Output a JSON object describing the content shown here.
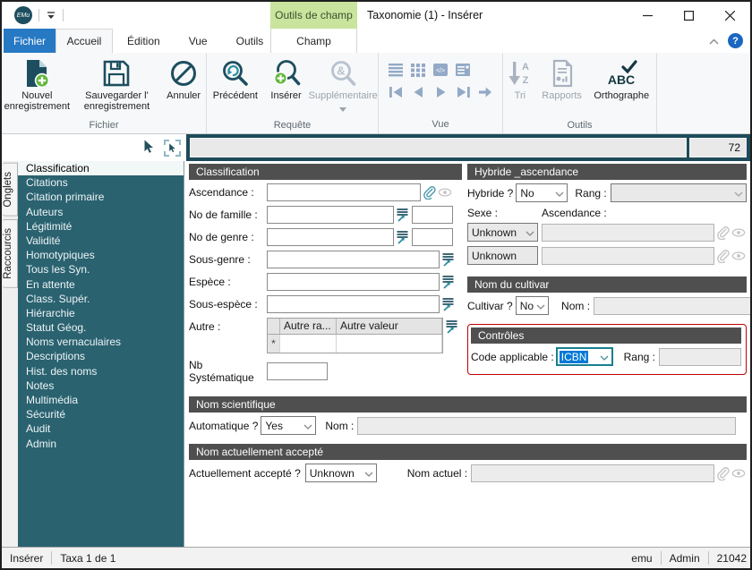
{
  "window": {
    "logo": "EMu",
    "title": "Taxonomie (1) - Insérer",
    "contextual_tab": "Outils de champ",
    "help": "?"
  },
  "tabs": {
    "fichier": "Fichier",
    "accueil": "Accueil",
    "edition": "Édition",
    "vue": "Vue",
    "outils": "Outils",
    "champ": "Champ"
  },
  "ribbon": {
    "groups": [
      {
        "label": "Fichier",
        "buttons": [
          {
            "label": "Nouvel enregistrement"
          },
          {
            "label": "Sauvegarder l' enregistrement"
          },
          {
            "label": "Annuler"
          }
        ]
      },
      {
        "label": "Requête",
        "buttons": [
          {
            "label": "Précédent"
          },
          {
            "label": "Insérer"
          },
          {
            "label": "Supplémentaire"
          }
        ]
      },
      {
        "label": "Vue"
      },
      {
        "label": "Outils",
        "buttons": [
          {
            "label": "Tri"
          },
          {
            "label": "Rapports"
          },
          {
            "label": "Orthographe"
          }
        ]
      }
    ]
  },
  "toolstrip": {
    "record_count": "72"
  },
  "sidebar": {
    "tabs": [
      "Onglets",
      "Raccourcis"
    ],
    "selected_index": 0,
    "items": [
      "Classification",
      "Citations",
      "Citation primaire",
      "Auteurs",
      "Légitimité",
      "Validité",
      "Homotypiques",
      "Tous les Syn.",
      "En attente",
      "Class. Supér.",
      "Hiérarchie",
      "Statut Géog.",
      "Noms vernaculaires",
      "Descriptions",
      "Hist. des noms",
      "Notes",
      "Multimédia",
      "Sécurité",
      "Audit",
      "Admin"
    ]
  },
  "form": {
    "classification": {
      "title": "Classification",
      "ascendance": "Ascendance :",
      "no_famille": "No de famille :",
      "no_genre": "No de genre :",
      "sous_genre": "Sous-genre :",
      "espece": "Espèce :",
      "sous_espece": "Sous-espèce :",
      "autre": "Autre :",
      "nb_syst": "Nb Systématique",
      "grid_cols": [
        "Autre ra...",
        "Autre valeur"
      ],
      "new_row_marker": "*"
    },
    "hybride": {
      "title": "Hybride _ascendance",
      "q": "Hybride ?",
      "value": "No",
      "rang": "Rang :",
      "sexe": "Sexe :",
      "ascendance": "Ascendance :",
      "sexe1": "Unknown",
      "sexe2": "Unknown"
    },
    "cultivar": {
      "title": "Nom du cultivar",
      "q": "Cultivar ?",
      "value": "No",
      "nom": "Nom :"
    },
    "controles": {
      "title": "Contrôles",
      "code": "Code applicable :",
      "code_value": "ICBN",
      "rang": "Rang :"
    },
    "sci": {
      "title": "Nom scientifique",
      "q": "Automatique ?",
      "value": "Yes",
      "nom": "Nom :"
    },
    "accepte": {
      "title": "Nom actuellement accepté",
      "q": "Actuellement accepté ?",
      "value": "Unknown",
      "nom": "Nom actuel :"
    }
  },
  "statusbar": {
    "mode": "Insérer",
    "record": "Taxa 1 de 1",
    "user": "emu",
    "role": "Admin",
    "code": "21042"
  },
  "colors": {
    "accent_teal": "#1d4e5f",
    "sidebar_teal": "#2a6270",
    "section_header": "#4f4f4f",
    "contextual_green": "#c8e49d",
    "file_tab_blue": "#2779c4",
    "highlight_red": "#c00000",
    "selection_blue": "#0078d7",
    "steel_icon": "#93a9c7",
    "green_plus": "#62b73c"
  }
}
